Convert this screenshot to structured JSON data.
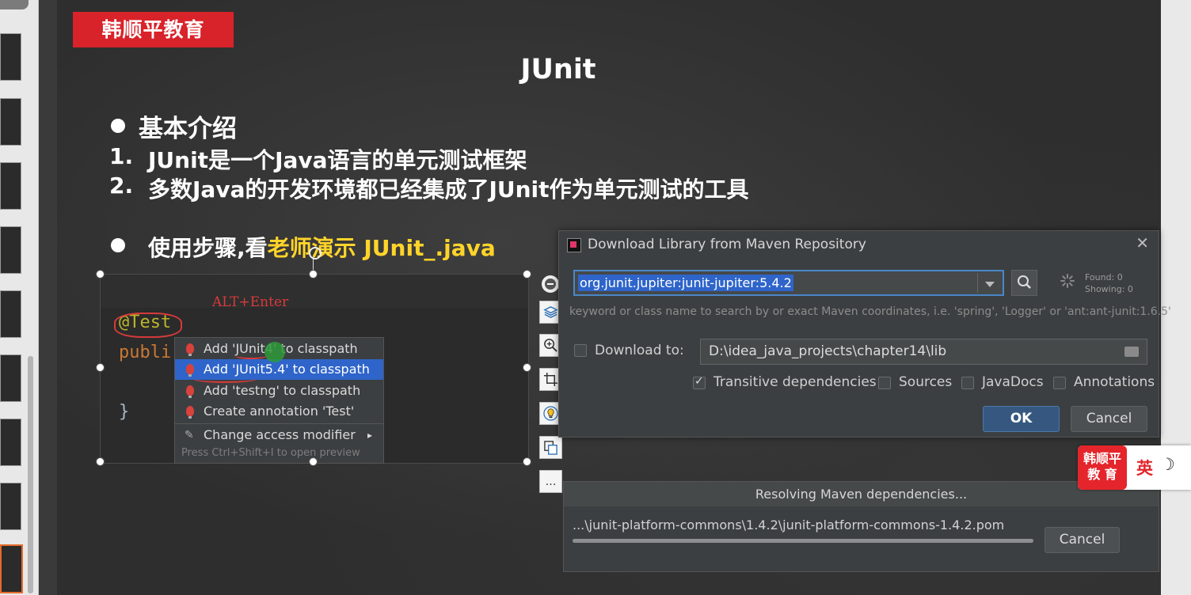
{
  "brand": {
    "name": "韩顺平教育"
  },
  "slide": {
    "title": "JUnit",
    "section1": "基本介绍",
    "point1_num": "1.",
    "point1_text": "JUnit是一个Java语言的单元测试框架",
    "point2_num": "2.",
    "point2_text": "多数Java的开发环境都已经集成了JUnit作为单元测试的工具",
    "section2_white": "使用步骤,看",
    "section2_yellow": "老师演示 JUnit_.java"
  },
  "ide": {
    "annotation_hint": "ALT+Enter",
    "code_annotation": "@Test",
    "code_line2": "publi",
    "code_line3": "}",
    "popup": {
      "items": [
        "Add 'JUnit4' to classpath",
        "Add 'JUnit5.4' to classpath",
        "Add 'testng' to classpath",
        "Create annotation 'Test'",
        "Change access modifier"
      ],
      "selected_index": 1,
      "submenu_arrow": "▸",
      "hint": "Press Ctrl+Shift+I to open preview"
    }
  },
  "toolbar": {
    "icons": [
      "minus-icon",
      "layers-icon",
      "zoom-icon",
      "crop-icon",
      "bulb-icon",
      "copy-icon",
      "more-icon"
    ],
    "more_label": "…"
  },
  "dialog": {
    "title": "Download Library from Maven Repository",
    "close": "✕",
    "search_value": "org.junit.jupiter:junit-jupiter:5.4.2",
    "found": "Found: 0",
    "showing": "Showing: 0",
    "hint": "keyword or class name to search by or exact Maven coordinates, i.e. 'spring', 'Logger' or 'ant:ant-junit:1.6.5'",
    "download_to_label": "Download to:",
    "download_to_checked": false,
    "download_path": "D:\\idea_java_projects\\chapter14\\lib",
    "options": [
      {
        "label": "Transitive dependencies",
        "checked": true
      },
      {
        "label": "Sources",
        "checked": false
      },
      {
        "label": "JavaDocs",
        "checked": false
      },
      {
        "label": "Annotations",
        "checked": false
      }
    ],
    "ok_label": "OK",
    "cancel_label": "Cancel"
  },
  "progress": {
    "title": "Resolving Maven dependencies...",
    "file": "...\\junit-platform-commons\\1.4.2\\junit-platform-commons-1.4.2.pom",
    "fraction": 1.0,
    "cancel_label": "Cancel"
  },
  "ime": {
    "logo_line1": "韩顺平",
    "logo_line2": "教 育",
    "lang": "英",
    "moon": "☽"
  },
  "colors": {
    "brand_red": "#d8232a",
    "highlight_yellow": "#ffd42a",
    "selection_blue": "#2f65ca"
  }
}
